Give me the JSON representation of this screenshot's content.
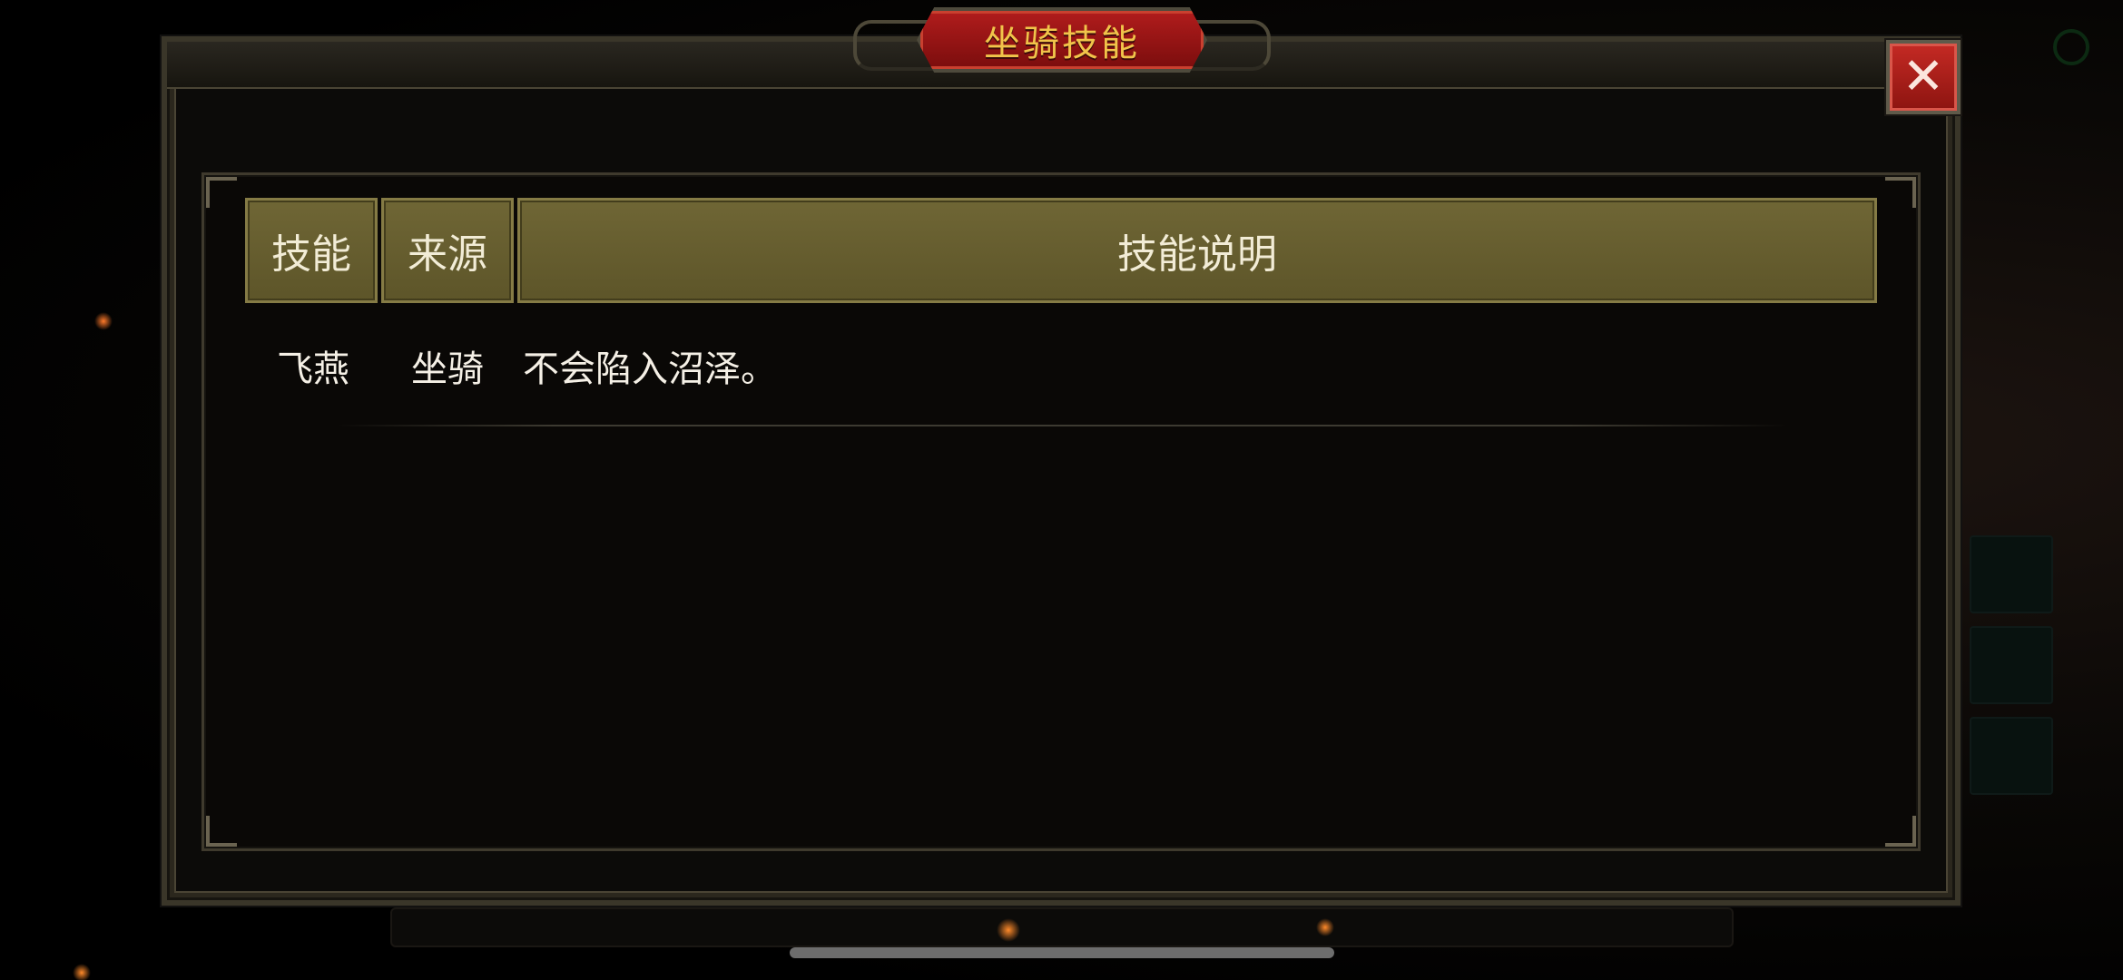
{
  "dialog": {
    "title": "坐骑技能",
    "close_glyph": "✕"
  },
  "table": {
    "headers": [
      "技能",
      "来源",
      "技能说明"
    ],
    "rows": [
      {
        "skill": "飞燕",
        "source": "坐骑",
        "description": "不会陷入沼泽。"
      }
    ]
  },
  "colors": {
    "title_plate": "#a01818",
    "title_text": "#f1c44a",
    "header_bg": "#655d2e",
    "text": "#f5f0e6",
    "close_button": "#b0201b"
  }
}
